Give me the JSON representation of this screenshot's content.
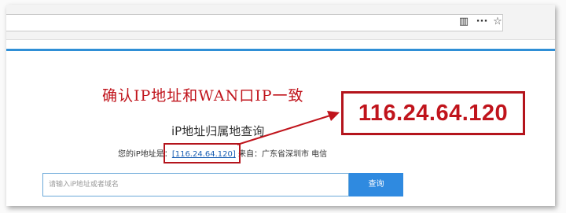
{
  "browser": {
    "reader_icon_glyph": "▥",
    "more_icon_glyph": "···",
    "bookmark_icon_glyph": "☆"
  },
  "annotation": {
    "instruction": "确认IP地址和WAN口IP一致",
    "highlighted_ip": "116.24.64.120"
  },
  "page": {
    "heading": "iP地址归属地查询",
    "ip_prefix": "您的iP地址是：",
    "ip_value": "[116.24.64.120]",
    "ip_from": "来自：广东省深圳市 电信",
    "search_placeholder": "请输入iP地址或者域名",
    "search_button": "查询"
  },
  "colors": {
    "annotation_red": "#c0141c",
    "accent_blue": "#2f8fd6",
    "button_blue": "#2f8ae0"
  }
}
